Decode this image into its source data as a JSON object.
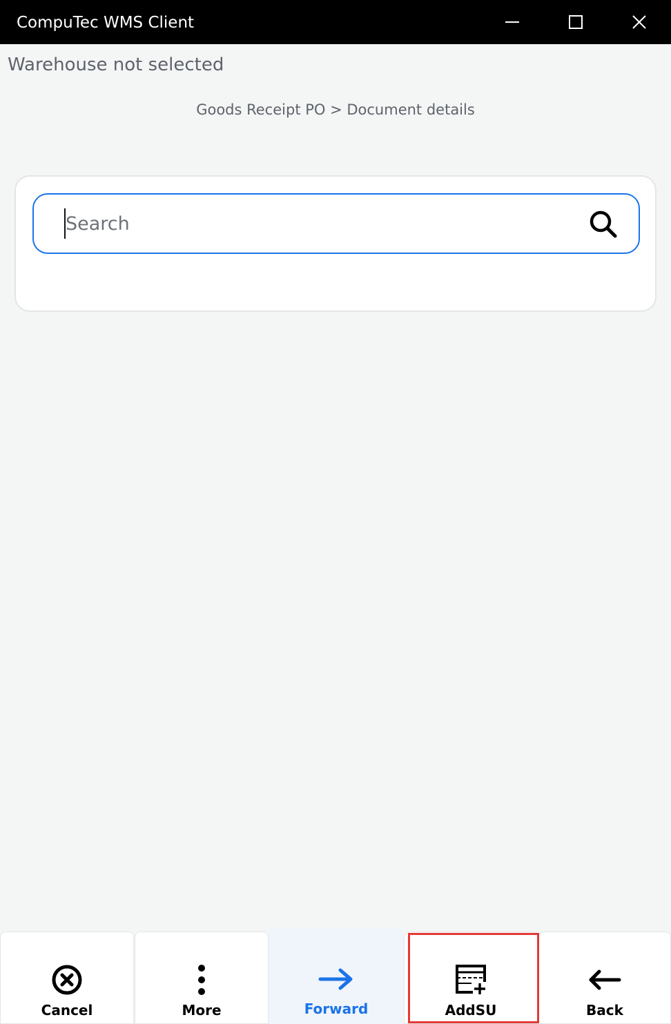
{
  "window": {
    "title": "CompuTec WMS Client",
    "controls": [
      "minimize-icon",
      "maximize-icon",
      "close-icon"
    ]
  },
  "header": {
    "warehouse_status": "Warehouse not selected",
    "breadcrumb": "Goods Receipt PO > Document details"
  },
  "search": {
    "placeholder": "Search",
    "value": "",
    "icon": "search-icon",
    "border_color": "#1a73e8"
  },
  "toolbar": {
    "cancel_label": "Cancel",
    "more_label": "More",
    "forward_label": "Forward",
    "addsu_label": "AddSU",
    "back_label": "Back",
    "accent_color": "#1a73e8",
    "highlight_color": "#e53935",
    "highlighted_button": "AddSU"
  }
}
